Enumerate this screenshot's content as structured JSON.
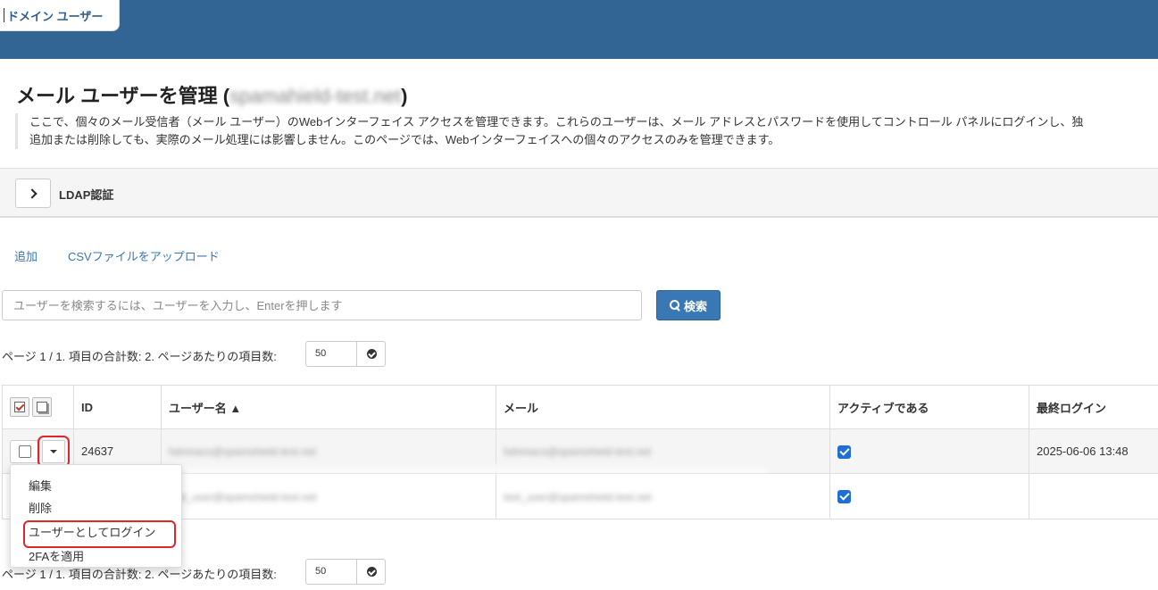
{
  "header": {
    "tab_label": "ドメイン ユーザー"
  },
  "page": {
    "title_prefix": "メール ユーザーを管理 (",
    "title_domain": "spamahield-test.net",
    "title_suffix": ")",
    "description_line1": "ここで、個々のメール受信者（メール ユーザー）のWebインターフェイス アクセスを管理できます。これらのユーザーは、メール アドレスとパスワードを使用してコントロール パネルにログインし、独",
    "description_line2": "追加または削除しても、実際のメール処理には影響しません。このページでは、Webインターフェイスへの個々のアクセスのみを管理できます。"
  },
  "ldap": {
    "label": "LDAP認証"
  },
  "actions": {
    "add": "追加",
    "upload_csv": "CSVファイルをアップロード"
  },
  "search": {
    "placeholder": "ユーザーを検索するには、ユーザーを入力し、Enterを押します",
    "button": "検索"
  },
  "pager_top": {
    "text": "ページ 1 / 1. 項目の合計数: 2. ページあたりの項目数:",
    "per_page": "50"
  },
  "pager_bottom": {
    "text": "ページ 1 / 1. 項目の合計数: 2. ページあたりの項目数:",
    "per_page": "50"
  },
  "table": {
    "columns": [
      "ID",
      "ユーザー名 ▲",
      "メール",
      "アクティブである",
      "最終ログイン"
    ],
    "rows": [
      {
        "id": "24637",
        "username": "hdnmacs@spamshield-test.net",
        "email": "hdnmacs@spamshield-test.net",
        "active": true,
        "last_login": "2025-06-06 13:48"
      },
      {
        "id": "",
        "username": "test_user@spamshield-test.net",
        "email": "test_user@spamshield-test.net",
        "active": true,
        "last_login": ""
      }
    ]
  },
  "row_menu": {
    "items": [
      "編集",
      "削除",
      "ユーザーとしてログイン",
      "2FAを適用"
    ]
  },
  "colors": {
    "header_bg": "#336594",
    "primary_button": "#3a78b5",
    "highlight": "#e0262b",
    "link": "#3a77b0"
  },
  "icons": [
    "chevron-right-icon",
    "search-icon",
    "check-circle-icon",
    "select-all-icon",
    "deselect-all-icon",
    "caret-down-icon",
    "checkbox-checked-icon"
  ]
}
